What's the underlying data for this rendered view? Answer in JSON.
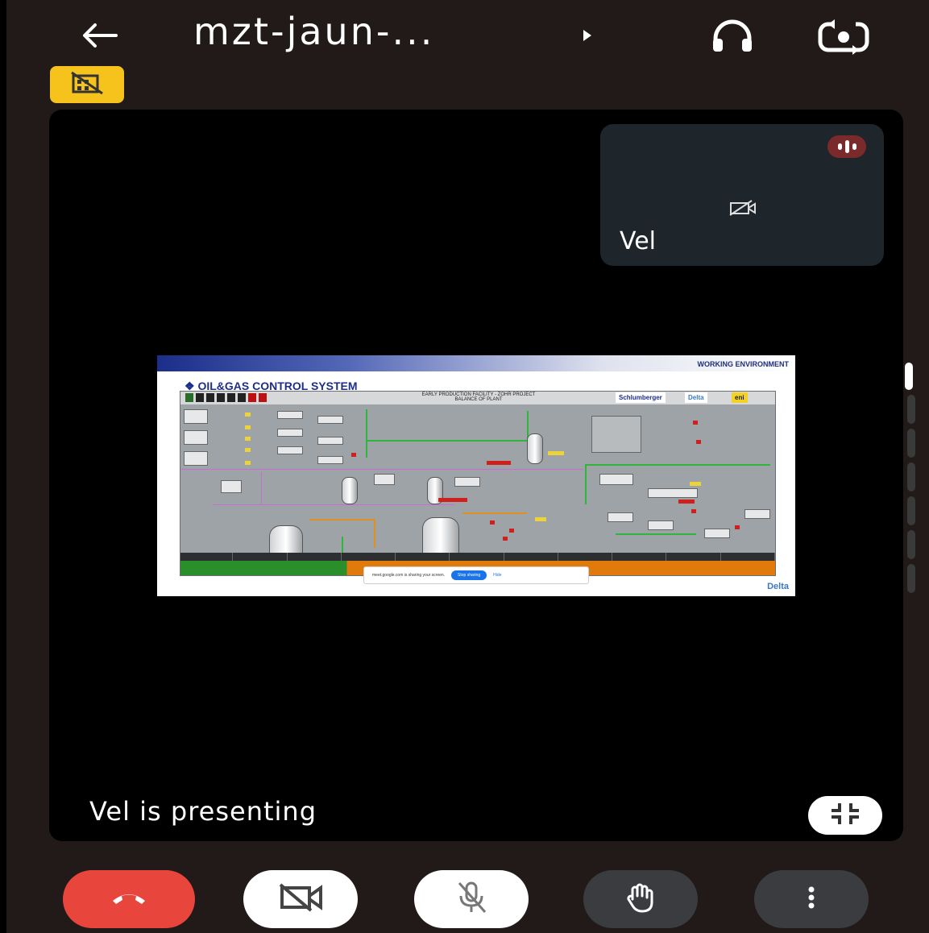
{
  "header": {
    "title": "mzt-jaun-...",
    "back_icon": "arrow-back-icon",
    "expand_icon": "caret-right-icon",
    "audio_icon": "headphones-icon",
    "camera_flip_icon": "flip-camera-icon"
  },
  "badge": {
    "icon": "no-building-icon",
    "color": "#f6c21c"
  },
  "participant_tile": {
    "name": "Vel",
    "speaking_icon": "audio-level-icon",
    "camera_status_icon": "camera-off-icon"
  },
  "shared_screen": {
    "slide_header": "WORKING ENVIRONMENT",
    "slide_title": "OIL&GAS CONTROL SYSTEM",
    "scada_subtitle_1": "EARLY PRODUCTION FACILITY - ZOHR PROJECT",
    "scada_subtitle_2": "BALANCE OF PLANT",
    "logos": [
      "Schlumberger",
      "Delta",
      "eni"
    ],
    "footer_logo": "Delta",
    "sharing_bar": {
      "message": "meet.google.com is sharing your screen.",
      "stop_label": "Stop sharing",
      "hide_label": "Hide"
    }
  },
  "presenter_label": "Vel is presenting",
  "controls": {
    "collapse_icon": "collapse-icon",
    "end_call_icon": "end-call-icon",
    "camera_icon": "camera-off-icon",
    "mic_icon": "mic-off-icon",
    "hand_icon": "raise-hand-icon",
    "more_icon": "more-vert-icon"
  },
  "colors": {
    "background": "#221a18",
    "end_call": "#e8453c",
    "dark_button": "#3a3c40",
    "tile": "#1e262b"
  }
}
